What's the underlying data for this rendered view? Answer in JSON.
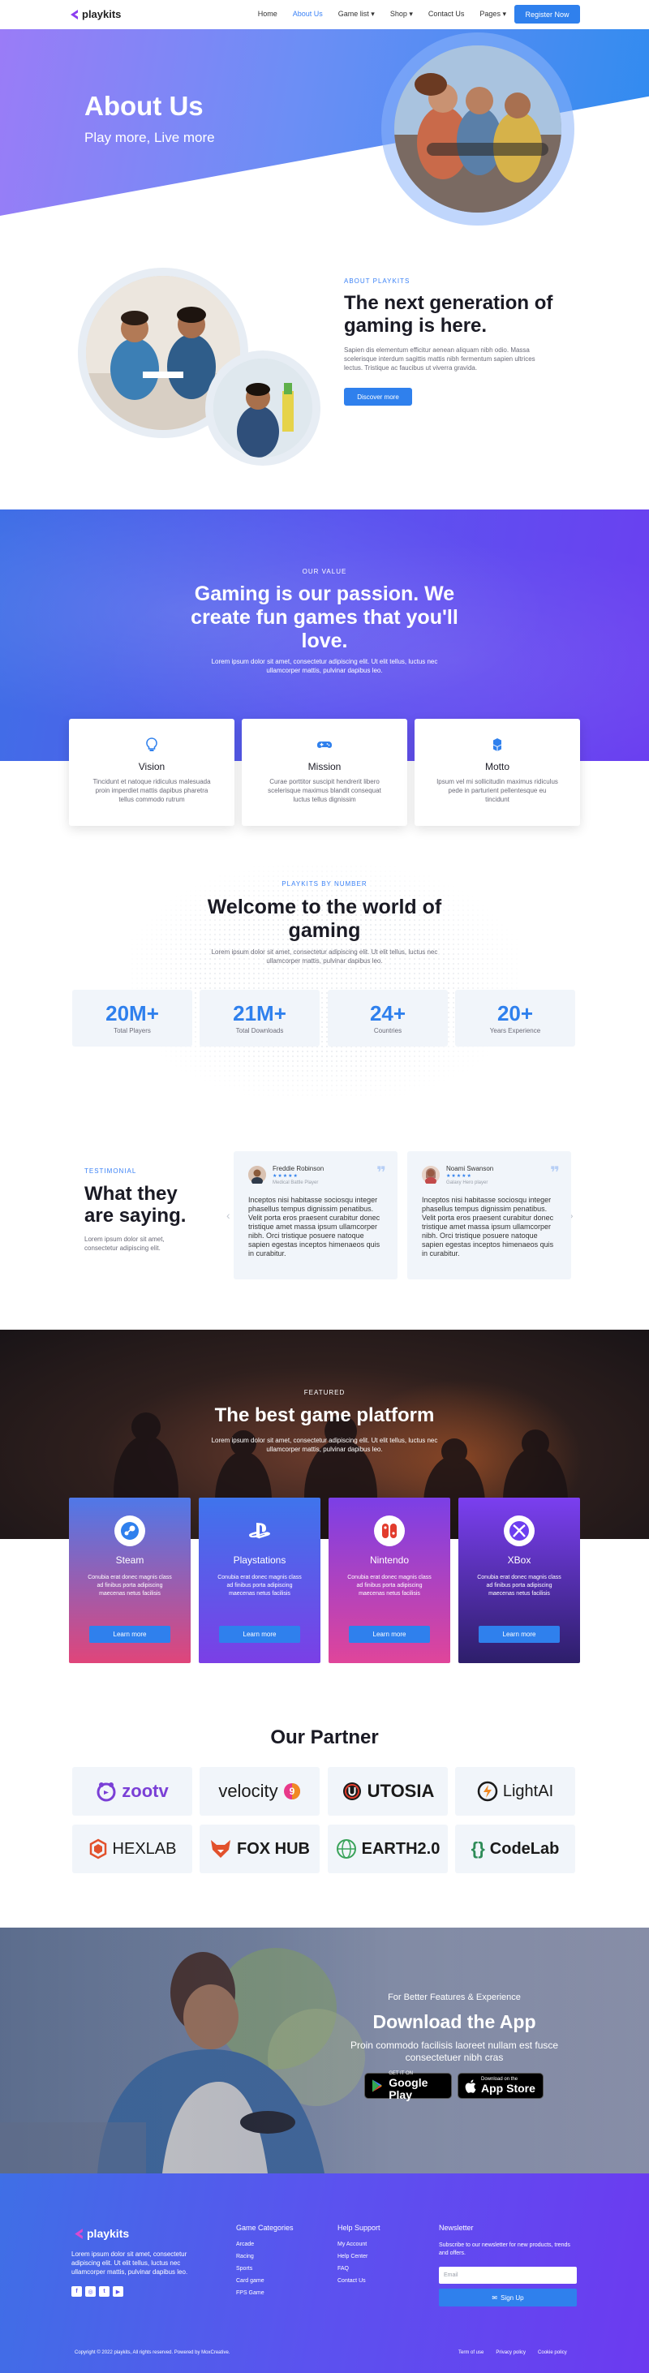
{
  "header": {
    "logo": "playkits",
    "nav": [
      {
        "label": "Home",
        "active": false,
        "dropdown": false
      },
      {
        "label": "About Us",
        "active": true,
        "dropdown": false
      },
      {
        "label": "Game list",
        "active": false,
        "dropdown": true
      },
      {
        "label": "Shop",
        "active": false,
        "dropdown": true
      },
      {
        "label": "Contact Us",
        "active": false,
        "dropdown": false
      },
      {
        "label": "Pages",
        "active": false,
        "dropdown": true
      }
    ],
    "register": "Register Now"
  },
  "hero": {
    "title": "About Us",
    "subtitle": "Play more, Live more"
  },
  "about": {
    "tag": "ABOUT PLAYKITS",
    "title": "The next generation of gaming is here.",
    "text": "Sapien dis elementum efficitur aenean aliquam nibh odio. Massa scelerisque interdum sagittis mattis nibh fermentum sapien ultrices lectus. Tristique ac faucibus ut viverra gravida.",
    "button": "Discover more"
  },
  "values": {
    "tag": "OUR VALUE",
    "title": "Gaming is our passion. We create fun games that you'll love.",
    "text": "Lorem ipsum dolor sit amet, consectetur adipiscing elit. Ut elit tellus, luctus nec ullamcorper mattis, pulvinar dapibus leo.",
    "cards": [
      {
        "title": "Vision",
        "text": "Tincidunt et natoque ridiculus malesuada proin imperdiet mattis dapibus pharetra tellus commodo rutrum",
        "icon": "lightbulb-icon"
      },
      {
        "title": "Mission",
        "text": "Curae porttitor suscipit hendrerit libero scelerisque maximus blandit consequat luctus tellus dignissim",
        "icon": "gamepad-icon"
      },
      {
        "title": "Motto",
        "text": "Ipsum vel mi sollicitudin maximus ridiculus pede in parturient pellentesque eu tincidunt",
        "icon": "cubes-icon"
      }
    ]
  },
  "numbers": {
    "tag": "PLAYKITS BY NUMBER",
    "title": "Welcome to the world of gaming",
    "text": "Lorem ipsum dolor sit amet, consectetur adipiscing elit. Ut elit tellus, luctus nec ullamcorper mattis, pulvinar dapibus leo.",
    "stats": [
      {
        "value": "20M+",
        "label": "Total Players"
      },
      {
        "value": "21M+",
        "label": "Total Downloads"
      },
      {
        "value": "24+",
        "label": "Countries"
      },
      {
        "value": "20+",
        "label": "Years Experience"
      }
    ]
  },
  "testimonials": {
    "tag": "TESTIMONIAL",
    "title": "What they are saying.",
    "text": "Lorem ipsum dolor sit amet, consectetur adipiscing elit.",
    "items": [
      {
        "name": "Freddie Robinson",
        "stars": "★★★★★",
        "role": "Medical Battle Player",
        "text": "Inceptos nisi habitasse sociosqu integer phasellus tempus dignissim penatibus. Velit porta eros praesent curabitur donec tristique amet massa ipsum ullamcorper nibh. Orci tristique posuere natoque sapien egestas inceptos himenaeos quis in curabitur."
      },
      {
        "name": "Noami Swanson",
        "stars": "★★★★★",
        "role": "Galaxy Hero player",
        "text": "Inceptos nisi habitasse sociosqu integer phasellus tempus dignissim penatibus. Velit porta eros praesent curabitur donec tristique amet massa ipsum ullamcorper nibh. Orci tristique posuere natoque sapien egestas inceptos himenaeos quis in curabitur."
      }
    ]
  },
  "featured": {
    "tag": "FEATURED",
    "title": "The best game platform",
    "text": "Lorem ipsum dolor sit amet, consectetur adipiscing elit. Ut elit tellus, luctus nec ullamcorper mattis, pulvinar dapibus leo.",
    "platforms": [
      {
        "name": "Steam",
        "text": "Conubia erat donec magnis class ad finibus porta adipiscing maecenas netus facilisis",
        "button": "Learn more",
        "color1": "#4f78e8",
        "color2": "#e0457a"
      },
      {
        "name": "Playstations",
        "text": "Conubia erat donec magnis class ad finibus porta adipiscing maecenas netus facilisis",
        "button": "Learn more",
        "color1": "#3f74ec",
        "color2": "#7b3fe6"
      },
      {
        "name": "Nintendo",
        "text": "Conubia erat donec magnis class ad finibus porta adipiscing maecenas netus facilisis",
        "button": "Learn more",
        "color1": "#7b3fe6",
        "color2": "#e0459a"
      },
      {
        "name": "XBox",
        "text": "Conubia erat donec magnis class ad finibus porta adipiscing maecenas netus facilisis",
        "button": "Learn more",
        "color1": "#7b3ff0",
        "color2": "#2d1e6a"
      }
    ]
  },
  "partners": {
    "title": "Our Partner",
    "items": [
      {
        "name": "zootv",
        "icon": "zootv-logo-icon",
        "color": "#7a3fd6"
      },
      {
        "name": "velocity",
        "icon": "velocity-logo-icon",
        "color": "#e8398a"
      },
      {
        "name": "UTOSIA",
        "icon": "utosia-logo-icon",
        "color": "#e23c2c"
      },
      {
        "name": "LightAI",
        "icon": "lightai-logo-icon",
        "color": "#f08a24"
      },
      {
        "name": "HEXLAB",
        "icon": "hexlab-logo-icon",
        "color": "#e2512c"
      },
      {
        "name": "FOX HUB",
        "icon": "foxhub-logo-icon",
        "color": "#e2512c"
      },
      {
        "name": "EARTH2.0",
        "icon": "earth-logo-icon",
        "color": "#3aa35a"
      },
      {
        "name": "CodeLab",
        "icon": "codelab-logo-icon",
        "color": "#2e8b57"
      }
    ]
  },
  "download": {
    "sub": "For Better Features & Experience",
    "title": "Download the App",
    "text": "Proin commodo facilisis laoreet nullam est fusce consectetuer nibh cras",
    "google_small": "GET IT ON",
    "google": "Google Play",
    "apple_small": "Download on the",
    "apple": "App Store"
  },
  "footer": {
    "logo": "playkits",
    "desc": "Lorem ipsum dolor sit amet, consectetur adipiscing elit. Ut elit tellus, luctus nec ullamcorper mattis, pulvinar dapibus leo.",
    "social": [
      "f",
      "◎",
      "t",
      "▶"
    ],
    "categories_title": "Game Categories",
    "categories": [
      "Arcade",
      "Racing",
      "Sports",
      "Card game",
      "FPS Game"
    ],
    "support_title": "Help Support",
    "support": [
      "My Account",
      "Help Center",
      "FAQ",
      "Contact Us"
    ],
    "newsletter_title": "Newsletter",
    "newsletter_text": "Subscribe to our newsletter for new products, trends and offers.",
    "email_placeholder": "Email",
    "signup": "Sign Up",
    "copyright": "Copyright © 2022 playkits, All rights reserved. Powered by MoxCreative.",
    "links": [
      "Term of use",
      "Privacy policy",
      "Cookie policy"
    ]
  }
}
